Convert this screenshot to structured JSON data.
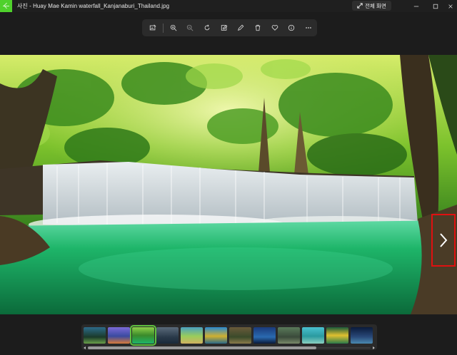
{
  "window": {
    "title": "사진 - Huay Mae Kamin waterfall_Kanjanaburi_Thailand.jpg",
    "fullscreen_label": "전체 화면",
    "app_color": "#4fd12c"
  },
  "toolbar": {
    "buttons": [
      {
        "icon": "edit-image-icon"
      },
      {
        "icon": "zoom-in-icon"
      },
      {
        "icon": "zoom-out-icon"
      },
      {
        "icon": "rotate-icon"
      },
      {
        "icon": "crop-edit-icon"
      },
      {
        "icon": "draw-icon"
      },
      {
        "icon": "delete-icon"
      },
      {
        "icon": "favorite-heart-icon"
      },
      {
        "icon": "info-icon"
      },
      {
        "icon": "more-options-icon"
      }
    ]
  },
  "filmstrip": {
    "thumbnail_count": 12,
    "selected_index": 2
  },
  "colors": {
    "highlight": "#e01010",
    "selection": "#5fc13f",
    "water": "#15a55a"
  }
}
